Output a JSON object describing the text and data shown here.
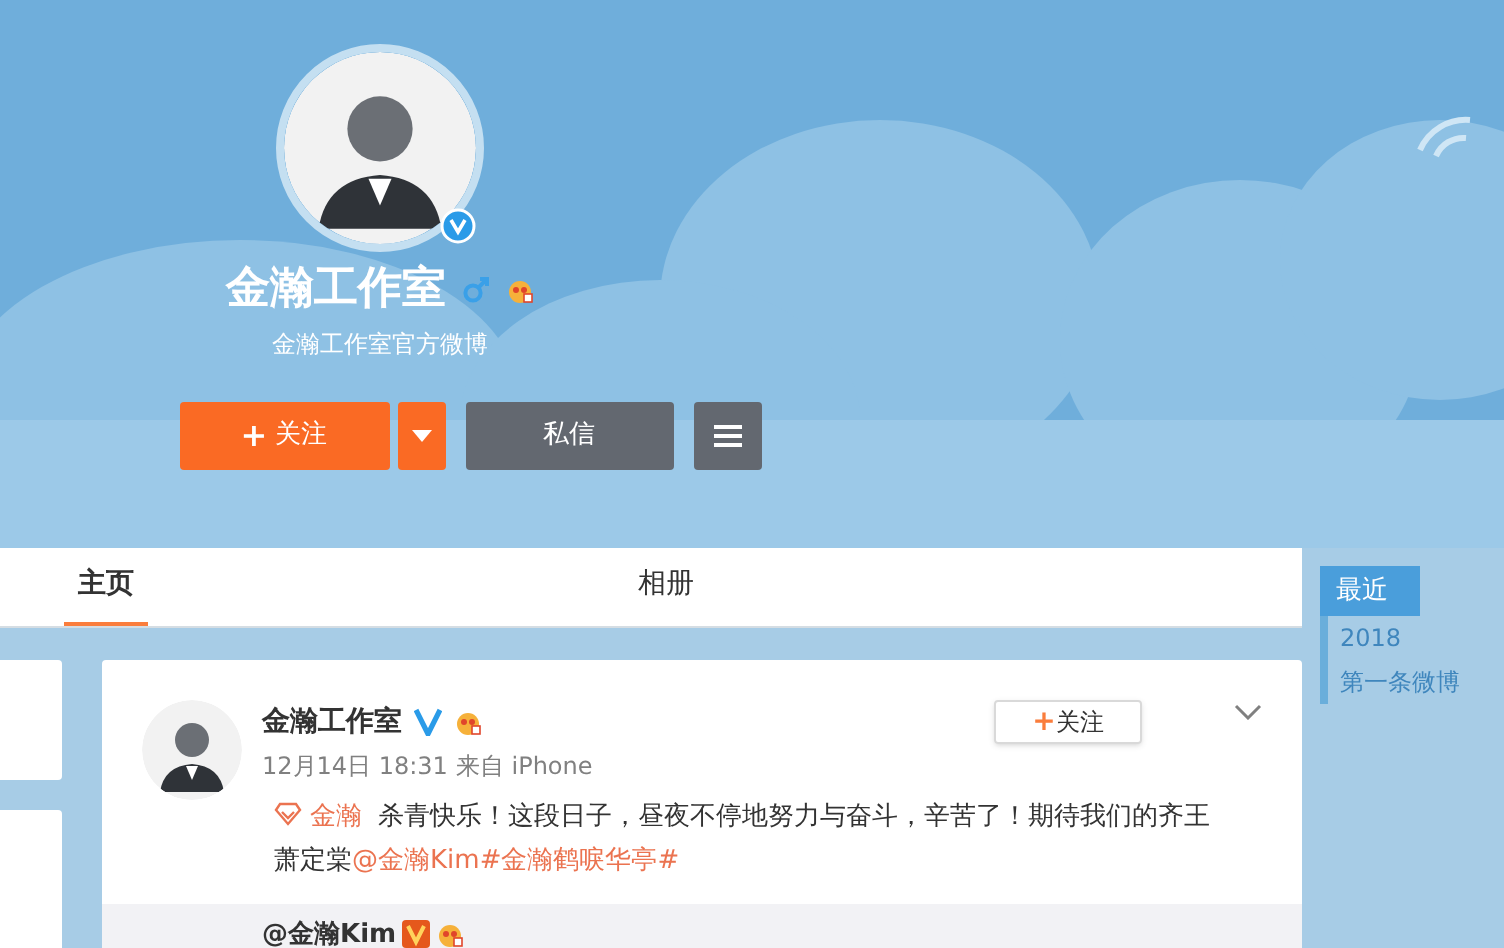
{
  "profile": {
    "name": "金瀚工作室",
    "description": "金瀚工作室官方微博",
    "follow_button": {
      "plus": "+",
      "label": "关注"
    },
    "message_button": "私信"
  },
  "tabs": [
    {
      "label": "主页",
      "selected": true
    },
    {
      "label": "相册",
      "selected": false
    }
  ],
  "timeline": [
    {
      "label": "最近",
      "selected": true
    },
    {
      "label": "2018",
      "selected": false
    },
    {
      "label": "第一条微博",
      "selected": false
    }
  ],
  "post": {
    "author": "金瀚工作室",
    "date": "12月14日 18:31",
    "source": "来自 iPhone",
    "follow_button": {
      "plus": "+",
      "label": "关注"
    },
    "segments": [
      {
        "kind": "super",
        "text": "金瀚"
      },
      {
        "kind": "text",
        "text": "杀青快乐！这段日子，昼夜不停地努力与奋斗，辛苦了！期待我们的齐王萧定棠"
      },
      {
        "kind": "link",
        "text": "@金瀚Kim"
      },
      {
        "kind": "link",
        "text": "#金瀚鹤唳华亭#"
      }
    ],
    "repost_author": "@金瀚Kim"
  }
}
